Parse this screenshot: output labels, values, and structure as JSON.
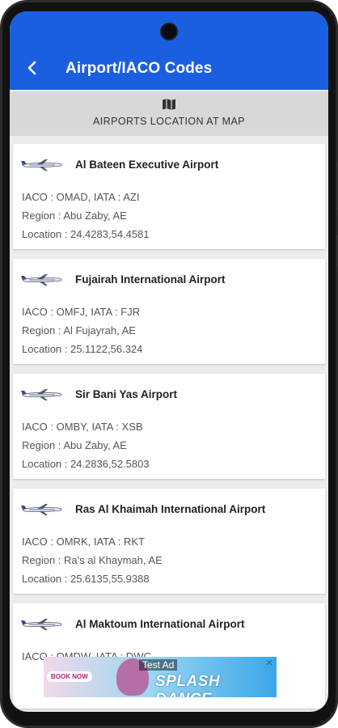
{
  "app_bar": {
    "title": "Airport/IACO Codes",
    "color": "#1a5fe0"
  },
  "map_banner": {
    "label": "AIRPORTS LOCATION AT MAP",
    "icon": "map-icon"
  },
  "airports": [
    {
      "name": "Al Bateen Executive Airport",
      "codes": "IACO : OMAD, IATA : AZI",
      "region": "Region : Abu Zaby, AE",
      "location": "Location : 24.4283,54.4581"
    },
    {
      "name": "Fujairah International Airport",
      "codes": "IACO : OMFJ, IATA : FJR",
      "region": "Region : Al Fujayrah, AE",
      "location": "Location : 25.1122,56.324"
    },
    {
      "name": "Sir Bani Yas Airport",
      "codes": "IACO : OMBY, IATA : XSB",
      "region": "Region : Abu Zaby, AE",
      "location": "Location : 24.2836,52.5803"
    },
    {
      "name": "Ras Al Khaimah International Airport",
      "codes": "IACO : OMRK, IATA : RKT",
      "region": "Region : Ra's al Khaymah, AE",
      "location": "Location : 25.6135,55.9388"
    },
    {
      "name": "Al Maktoum International Airport",
      "codes": "IACO : OMDW, IATA : DWC",
      "region": "",
      "location": ""
    }
  ],
  "ad": {
    "badge": "Test Ad",
    "headline": "SPLASH DANCE",
    "cta": "BOOK NOW"
  }
}
